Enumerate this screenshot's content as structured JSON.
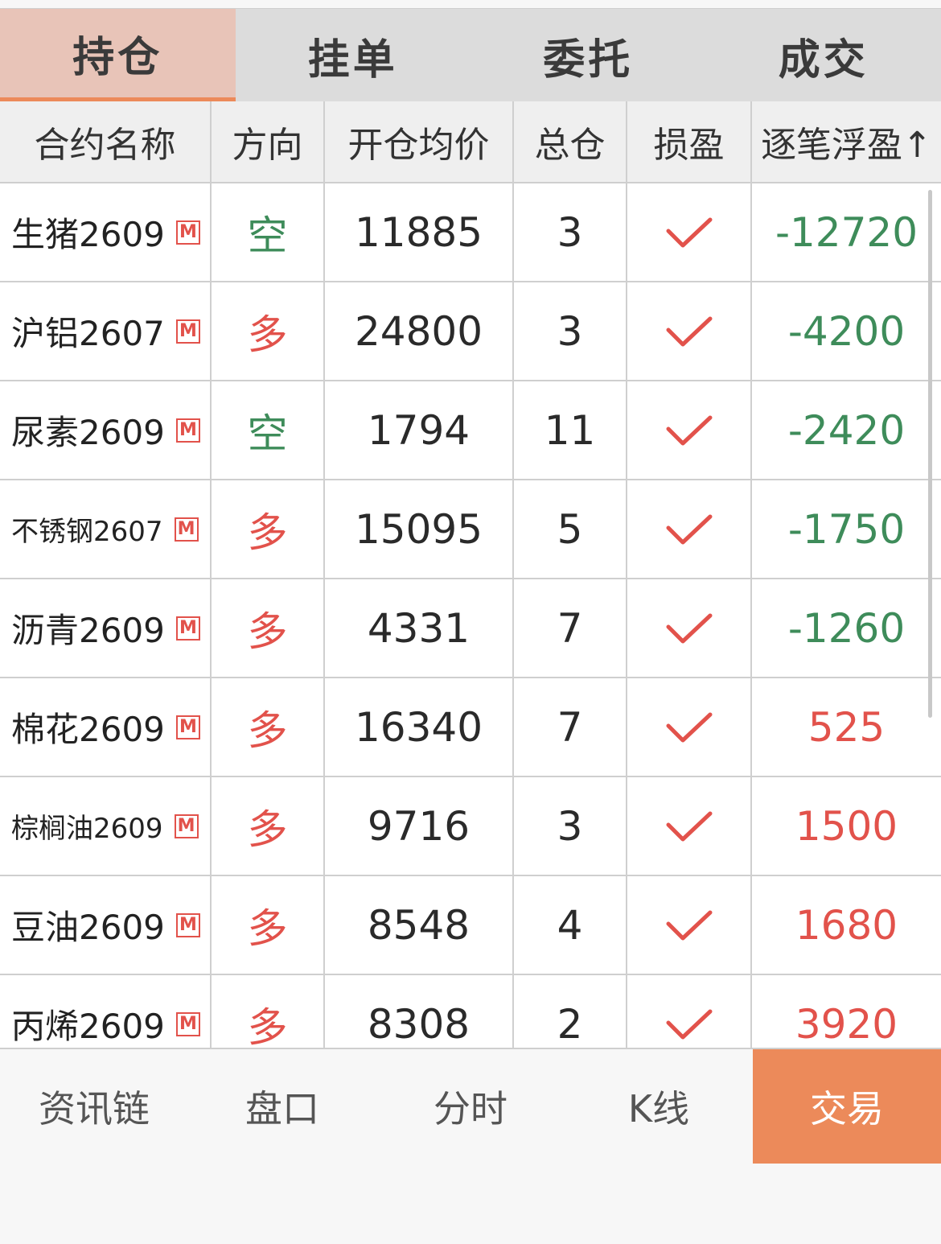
{
  "tabs": [
    {
      "label": "持仓",
      "active": true
    },
    {
      "label": "挂单",
      "active": false
    },
    {
      "label": "委托",
      "active": false
    },
    {
      "label": "成交",
      "active": false
    }
  ],
  "table": {
    "headers": [
      "合约名称",
      "方向",
      "开仓均价",
      "总仓",
      "损盈",
      "逐笔浮盈↑"
    ],
    "badge": "M",
    "rows": [
      {
        "name": "生猪2609",
        "direction": "空",
        "avg_price": "11885",
        "total": "3",
        "pnl": "-12720"
      },
      {
        "name": "沪铝2607",
        "direction": "多",
        "avg_price": "24800",
        "total": "3",
        "pnl": "-4200"
      },
      {
        "name": "尿素2609",
        "direction": "空",
        "avg_price": "1794",
        "total": "11",
        "pnl": "-2420"
      },
      {
        "name": "不锈钢2607",
        "direction": "多",
        "avg_price": "15095",
        "total": "5",
        "pnl": "-1750"
      },
      {
        "name": "沥青2609",
        "direction": "多",
        "avg_price": "4331",
        "total": "7",
        "pnl": "-1260"
      },
      {
        "name": "棉花2609",
        "direction": "多",
        "avg_price": "16340",
        "total": "7",
        "pnl": "525"
      },
      {
        "name": "棕榈油2609",
        "direction": "多",
        "avg_price": "9716",
        "total": "3",
        "pnl": "1500"
      },
      {
        "name": "豆油2609",
        "direction": "多",
        "avg_price": "8548",
        "total": "4",
        "pnl": "1680"
      },
      {
        "name": "丙烯2609",
        "direction": "多",
        "avg_price": "8308",
        "total": "2",
        "pnl": "3920"
      }
    ]
  },
  "bottom_nav": [
    {
      "label": "资讯链",
      "active": false
    },
    {
      "label": "盘口",
      "active": false
    },
    {
      "label": "分时",
      "active": false
    },
    {
      "label": "K线",
      "active": false
    },
    {
      "label": "交易",
      "active": true
    }
  ],
  "colors": {
    "accent": "#ec8a5a",
    "active_tab_bg": "#e8c4b8",
    "profit": "#e2524b",
    "loss": "#3e8c5a"
  }
}
